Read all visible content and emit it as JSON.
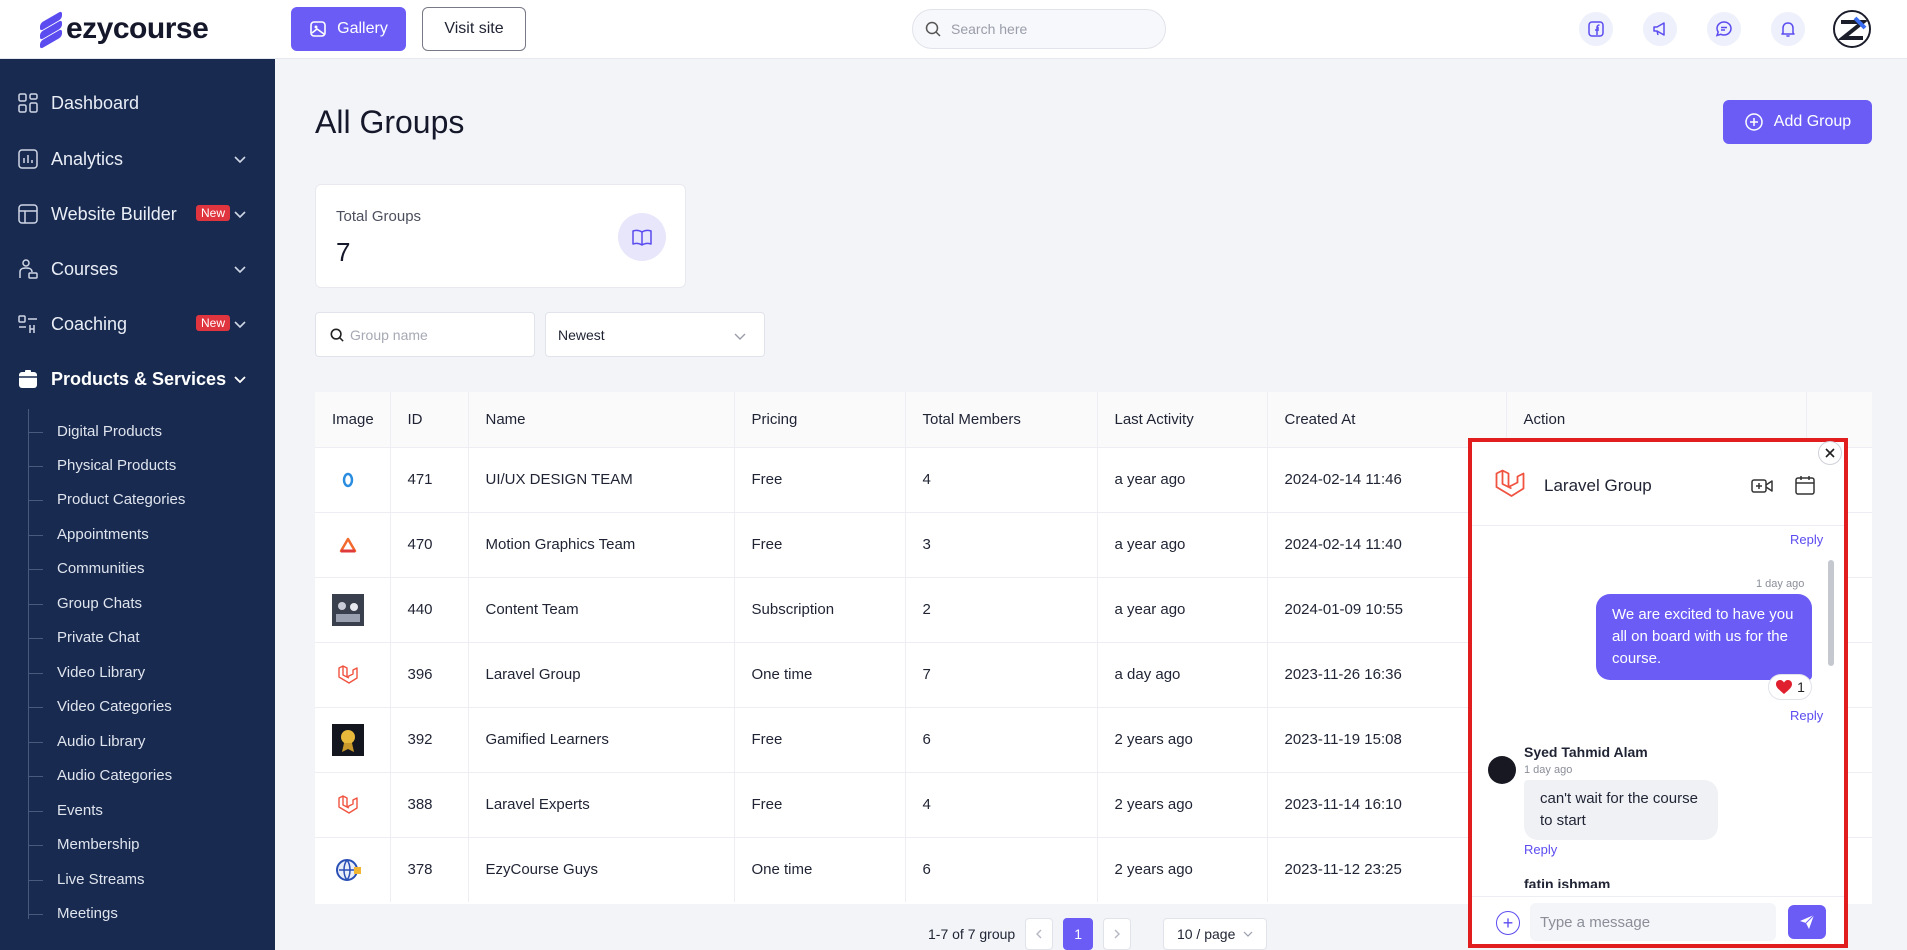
{
  "header": {
    "logo_text": "ezycourse",
    "gallery_label": "Gallery",
    "visit_label": "Visit site",
    "search_placeholder": "Search here"
  },
  "sidebar": {
    "items": [
      {
        "label": "Dashboard",
        "icon": "dashboard-icon",
        "has_chevron": false
      },
      {
        "label": "Analytics",
        "icon": "analytics-icon",
        "has_chevron": true
      },
      {
        "label": "Website Builder",
        "icon": "website-builder-icon",
        "has_chevron": true,
        "badge": "New"
      },
      {
        "label": "Courses",
        "icon": "courses-icon",
        "has_chevron": true
      },
      {
        "label": "Coaching",
        "icon": "coaching-icon",
        "has_chevron": true,
        "badge": "New"
      },
      {
        "label": "Products & Services",
        "icon": "products-icon",
        "has_chevron": true,
        "active": true
      }
    ],
    "sub_items": [
      "Digital Products",
      "Physical Products",
      "Product Categories",
      "Appointments",
      "Communities",
      "Group Chats",
      "Private Chat",
      "Video Library",
      "Video Categories",
      "Audio Library",
      "Audio Categories",
      "Events",
      "Membership",
      "Live Streams",
      "Meetings"
    ]
  },
  "main": {
    "title": "All Groups",
    "add_button": "Add Group",
    "stat": {
      "label": "Total Groups",
      "value": "7"
    },
    "filter": {
      "search_placeholder": "Group name",
      "sort_value": "Newest"
    }
  },
  "table": {
    "columns": [
      "Image",
      "ID",
      "Name",
      "Pricing",
      "Total Members",
      "Last Activity",
      "Created At",
      "Action"
    ],
    "rows": [
      {
        "id": "471",
        "name": "UI/UX DESIGN TEAM",
        "pricing": "Free",
        "members": "4",
        "activity": "a year ago",
        "created": "2024-02-14 11:46",
        "thumb": "uiux"
      },
      {
        "id": "470",
        "name": "Motion Graphics Team",
        "pricing": "Free",
        "members": "3",
        "activity": "a year ago",
        "created": "2024-02-14 11:40",
        "thumb": "motion"
      },
      {
        "id": "440",
        "name": "Content Team",
        "pricing": "Subscription",
        "members": "2",
        "activity": "a year ago",
        "created": "2024-01-09 10:55",
        "thumb": "photo"
      },
      {
        "id": "396",
        "name": "Laravel Group",
        "pricing": "One time",
        "members": "7",
        "activity": "a day ago",
        "created": "2023-11-26 16:36",
        "thumb": "laravel"
      },
      {
        "id": "392",
        "name": "Gamified Learners",
        "pricing": "Free",
        "members": "6",
        "activity": "2 years ago",
        "created": "2023-11-19 15:08",
        "thumb": "medal"
      },
      {
        "id": "388",
        "name": "Laravel Experts",
        "pricing": "Free",
        "members": "4",
        "activity": "2 years ago",
        "created": "2023-11-14 16:10",
        "thumb": "laravel"
      },
      {
        "id": "378",
        "name": "EzyCourse Guys",
        "pricing": "One time",
        "members": "6",
        "activity": "2 years ago",
        "created": "2023-11-12 23:25",
        "thumb": "globe"
      }
    ]
  },
  "pagination": {
    "summary": "1-7 of 7 group",
    "current": "1",
    "page_size": "10 / page"
  },
  "chat": {
    "title": "Laravel Group",
    "reply_label": "Reply",
    "messages": [
      {
        "time": "1 day ago",
        "text": "We are excited to have you all on board with us for the course.",
        "reaction_count": "1"
      },
      {
        "sender": "Syed Tahmid Alam",
        "time": "1 day ago",
        "text": "can't wait for the course to start"
      },
      {
        "sender": "fatin ishmam"
      }
    ],
    "input_placeholder": "Type a message"
  },
  "colors": {
    "primary": "#6a5cf5",
    "sidebar": "#182a4f",
    "highlight": "#e21d1d"
  }
}
